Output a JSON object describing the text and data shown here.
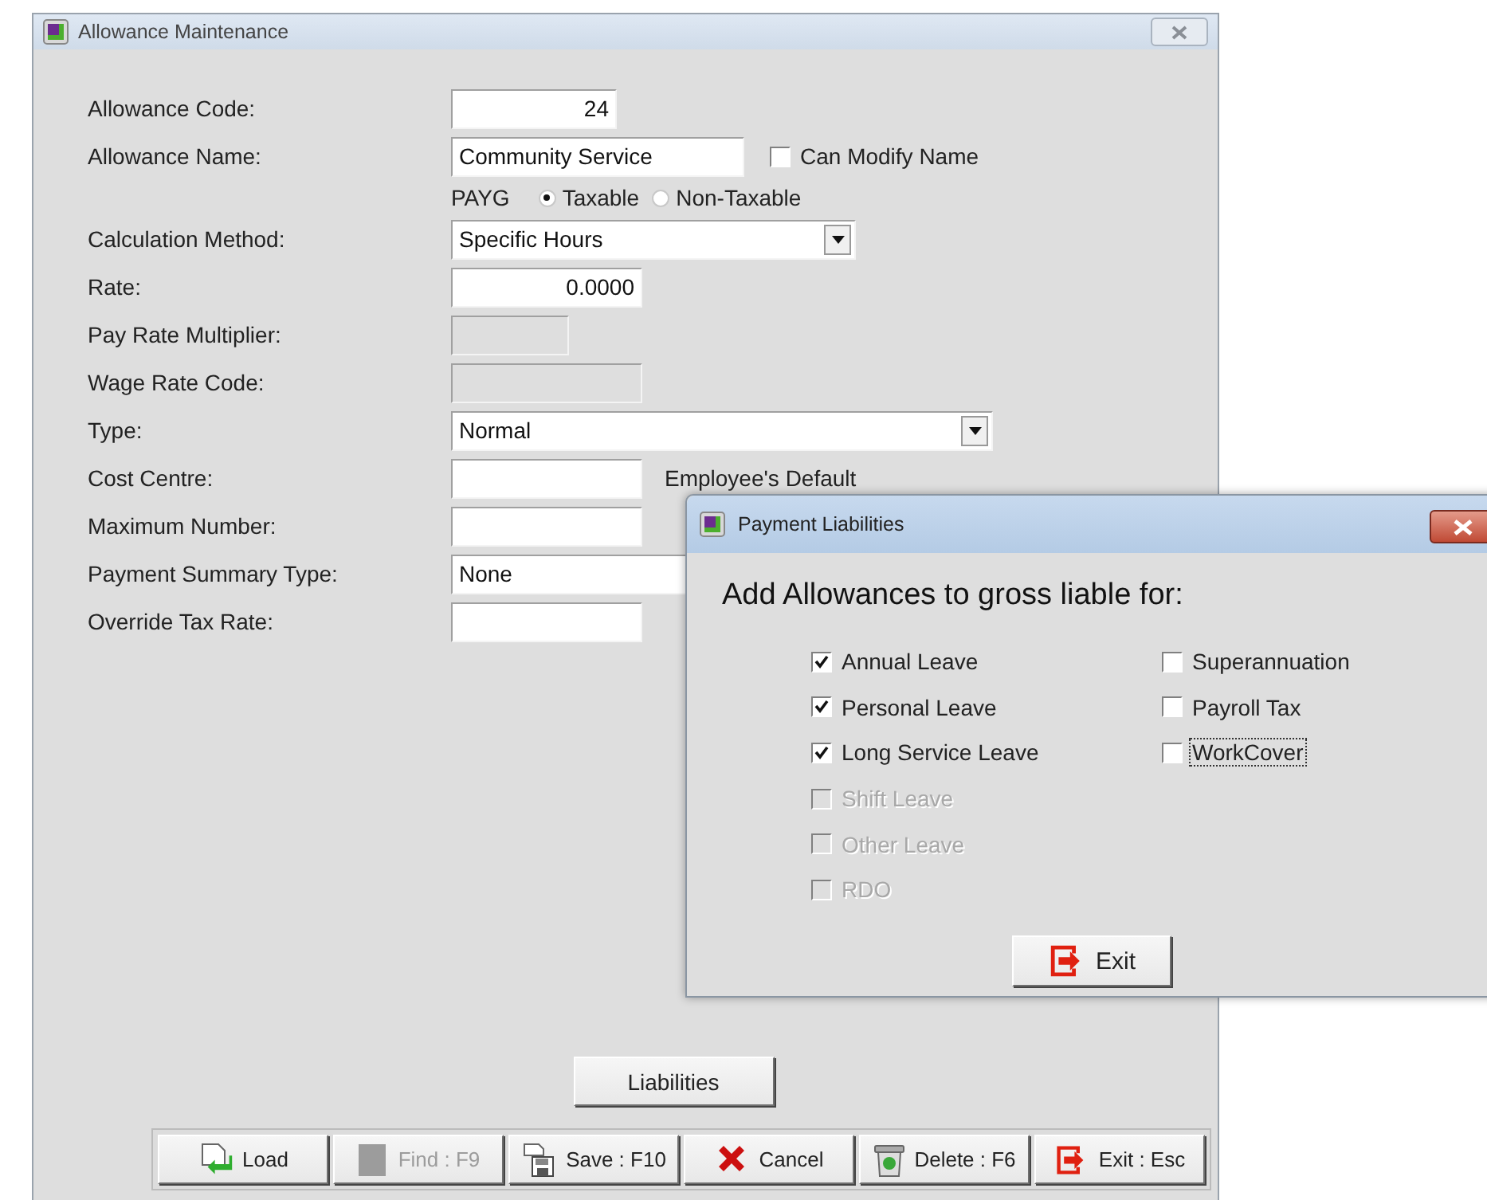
{
  "window": {
    "title": "Allowance Maintenance"
  },
  "form": {
    "fields": [
      {
        "kind": "text",
        "label": "Allowance Code:",
        "value": "24",
        "numeric": true
      },
      {
        "kind": "text",
        "label": "Allowance Name:",
        "value": "Community Service",
        "numeric": false,
        "option": {
          "label": "Can Modify Name",
          "checked": false
        }
      },
      {
        "kind": "radio",
        "label": "PAYG",
        "options": [
          {
            "label": "Taxable",
            "selected": true
          },
          {
            "label": "Non-Taxable",
            "selected": false
          }
        ]
      },
      {
        "kind": "combo",
        "label": "Calculation Method:",
        "value": "Specific Hours"
      },
      {
        "kind": "text",
        "label": "Rate:",
        "value": "0.0000",
        "numeric": true
      },
      {
        "kind": "disabled",
        "label": "Pay Rate Multiplier:"
      },
      {
        "kind": "disabled",
        "label": "Wage Rate Code:"
      },
      {
        "kind": "combo",
        "label": "Type:",
        "value": "Normal"
      },
      {
        "kind": "text",
        "label": "Cost Centre:",
        "note": "Employee's Default"
      },
      {
        "kind": "text",
        "label": "Maximum Number:"
      },
      {
        "kind": "combo",
        "label": "Payment Summary Type:",
        "value": "None"
      },
      {
        "kind": "text",
        "label": "Override Tax Rate:"
      }
    ]
  },
  "liabilities_button": "Liabilities",
  "toolbar": [
    {
      "kind": "load",
      "label": "Load",
      "disabled": false
    },
    {
      "kind": "find",
      "label": "Find : F9",
      "disabled": true
    },
    {
      "kind": "save",
      "label": "Save : F10",
      "disabled": false
    },
    {
      "kind": "cancel",
      "label": "Cancel",
      "disabled": false
    },
    {
      "kind": "delete",
      "label": "Delete : F6",
      "disabled": false
    },
    {
      "kind": "exit",
      "label": "Exit : Esc",
      "disabled": false
    }
  ],
  "dialog": {
    "title": "Payment Liabilities",
    "heading": "Add Allowances to gross liable for:",
    "columns": [
      [
        {
          "label": "Annual Leave",
          "checked": true,
          "disabled": false,
          "focused": false
        },
        {
          "label": "Personal Leave",
          "checked": true,
          "disabled": false,
          "focused": false
        },
        {
          "label": "Long Service Leave",
          "checked": true,
          "disabled": false,
          "focused": false
        },
        {
          "label": "Shift Leave",
          "checked": false,
          "disabled": true,
          "focused": false
        },
        {
          "label": "Other Leave",
          "checked": false,
          "disabled": true,
          "focused": false
        },
        {
          "label": "RDO",
          "checked": false,
          "disabled": true,
          "focused": false
        }
      ],
      [
        {
          "label": "Superannuation",
          "checked": false,
          "disabled": false,
          "focused": false
        },
        {
          "label": "Payroll Tax",
          "checked": false,
          "disabled": false,
          "focused": false
        },
        {
          "label": "WorkCover",
          "checked": false,
          "disabled": false,
          "focused": true
        }
      ]
    ],
    "button": "Exit"
  }
}
